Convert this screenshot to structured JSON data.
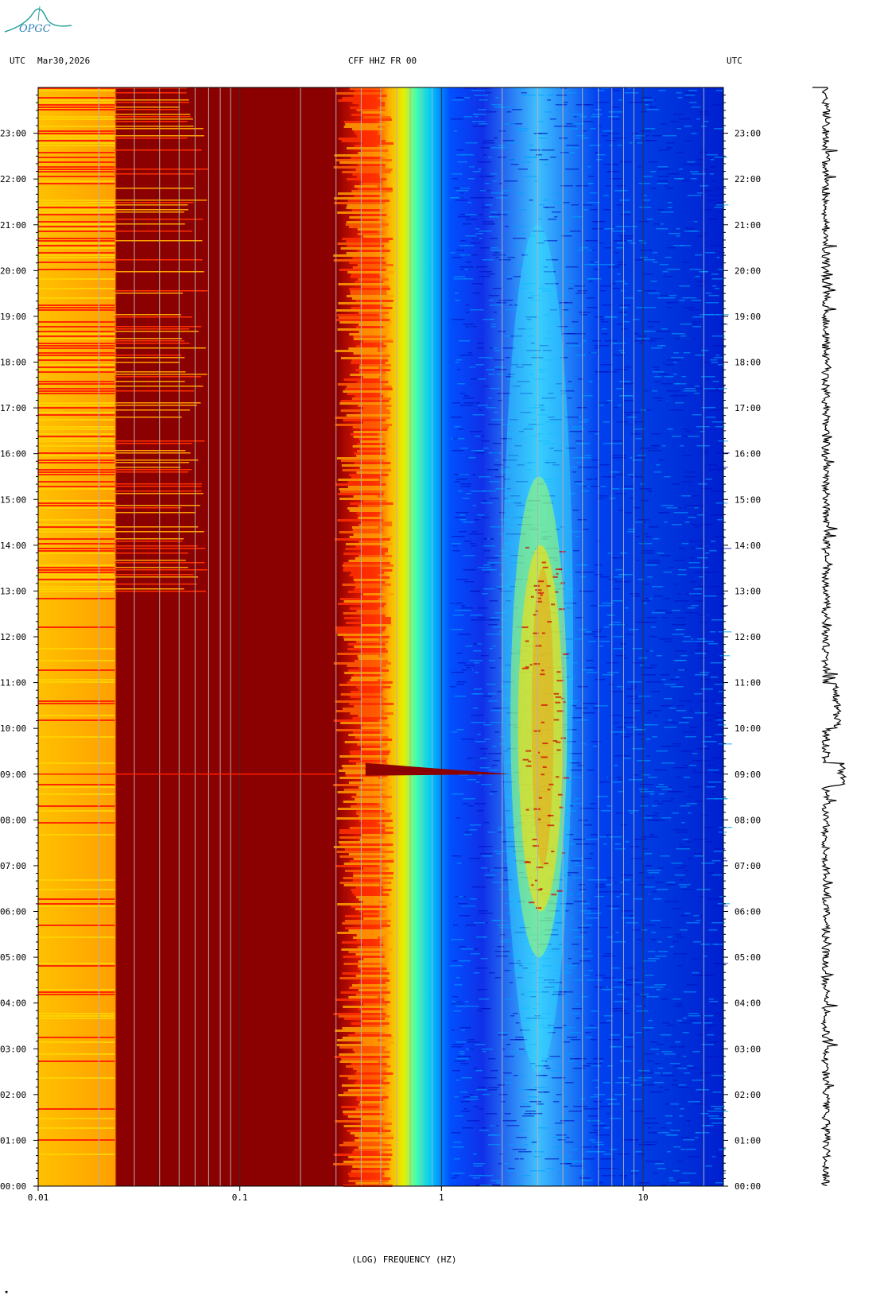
{
  "header": {
    "left_tz": "UTC",
    "date": "Mar30,2026",
    "station": "CFF HHZ FR 00",
    "right_tz": "UTC"
  },
  "logo": {
    "text": "OPGC",
    "color": "#2aa39a"
  },
  "chart_data": {
    "type": "heatmap",
    "title": "CFF HHZ FR 00",
    "xlabel": "(LOG) FREQUENCY (HZ)",
    "x_scale": "log",
    "xlim": [
      0.01,
      25
    ],
    "x_ticks": [
      "0.01",
      "0.1",
      "1",
      "10"
    ],
    "y_ticks": [
      "00:00",
      "01:00",
      "02:00",
      "03:00",
      "04:00",
      "05:00",
      "06:00",
      "07:00",
      "08:00",
      "09:00",
      "10:00",
      "11:00",
      "12:00",
      "13:00",
      "14:00",
      "15:00",
      "16:00",
      "17:00",
      "18:00",
      "19:00",
      "20:00",
      "21:00",
      "22:00",
      "23:00"
    ],
    "ylim_hours": [
      0,
      24
    ],
    "colormap": [
      "#00008b",
      "#0033ff",
      "#00bfff",
      "#7fff7f",
      "#ffff00",
      "#ff8c00",
      "#ff0000",
      "#8b0000"
    ],
    "grid_frequencies_hz": [
      0.02,
      0.03,
      0.04,
      0.05,
      0.06,
      0.07,
      0.08,
      0.09,
      0.2,
      0.3,
      0.4,
      0.5,
      0.6,
      0.7,
      0.8,
      0.9,
      2,
      3,
      4,
      5,
      6,
      7,
      8,
      9,
      20
    ],
    "events": [
      {
        "time_utc": "09:00",
        "description": "broadband transient"
      }
    ]
  }
}
